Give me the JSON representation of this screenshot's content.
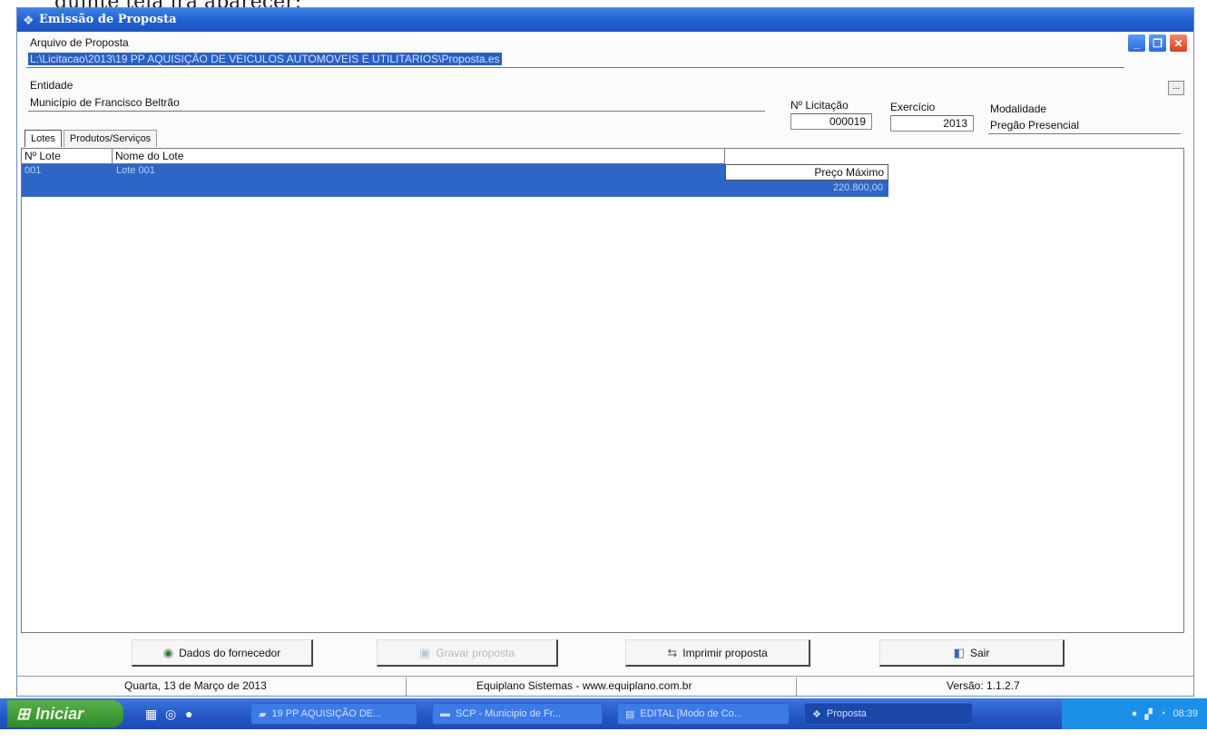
{
  "doc_text": "guinte tela irá aparecer:",
  "window": {
    "title": "Emissão de Proposta",
    "controls": [
      "minimize",
      "restore",
      "close"
    ]
  },
  "form": {
    "arquivo_label": "Arquivo de Proposta",
    "arquivo_value": "L:\\Licitacao\\2013\\19 PP AQUISIÇÃO DE VEICULOS AUTOMOVEIS E UTILITARIOS\\Proposta.es",
    "browse_label": "...",
    "entidade_label": "Entidade",
    "entidade_value": "Município de Francisco Beltrão",
    "licitacao_label": "Nº Licitação",
    "licitacao_value": "000019",
    "exercicio_label": "Exercício",
    "exercicio_value": "2013",
    "modalidade_label": "Modalidade",
    "modalidade_value": "Pregão Presencial"
  },
  "tabs": [
    {
      "label": "Lotes",
      "active": true
    },
    {
      "label": "Produtos/Serviços",
      "active": false
    }
  ],
  "grid": {
    "columns": [
      "Nº Lote",
      "Nome do Lote",
      "Preço Máximo"
    ],
    "rows": [
      {
        "numero": "001",
        "nome": "Lote 001",
        "preco": "220.800,00",
        "selected": true
      }
    ]
  },
  "buttons": {
    "fornecedor": "Dados do fornecedor",
    "gravar": "Gravar proposta",
    "imprimir": "Imprimir proposta",
    "sair": "Sair"
  },
  "status": {
    "date": "Quarta, 13 de Março de 2013",
    "company": "Equiplano Sistemas - www.equiplano.com.br",
    "version": "Versão: 1.1.2.7"
  },
  "taskbar": {
    "start": "Iniciar",
    "tasks": [
      {
        "label": "19 PP AQUISIÇÃO DE...",
        "icon": "folder-icon"
      },
      {
        "label": "SCP - Municipio de Fr...",
        "icon": "app-icon"
      },
      {
        "label": "EDITAL [Modo de Co...",
        "icon": "word-icon"
      },
      {
        "label": "Proposta",
        "icon": "proposta-icon",
        "active": true
      }
    ],
    "clock": "08:39"
  },
  "colors": {
    "title_blue": "#1f5fcf",
    "selection": "#2e66c5",
    "taskbar": "#2554c4",
    "start_green": "#3a9a30"
  }
}
